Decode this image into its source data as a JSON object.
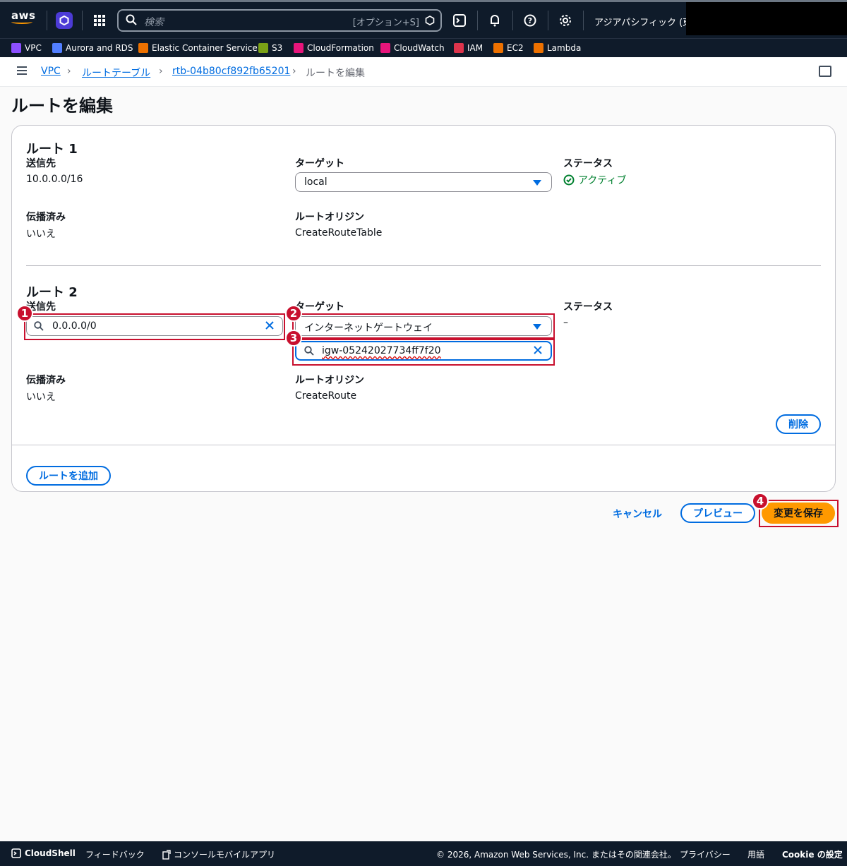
{
  "topbar": {
    "logo": "aws",
    "search_placeholder": "検索",
    "search_shortcut": "[オプション+S]",
    "region": "アジアパシフィック (東京)"
  },
  "bookmarks": [
    {
      "label": "VPC",
      "color": "#8c4fff"
    },
    {
      "label": "Aurora and RDS",
      "color": "#527fff"
    },
    {
      "label": "Elastic Container Service",
      "color": "#ed7100"
    },
    {
      "label": "S3",
      "color": "#7aa116"
    },
    {
      "label": "CloudFormation",
      "color": "#e7157b"
    },
    {
      "label": "CloudWatch",
      "color": "#e7157b"
    },
    {
      "label": "IAM",
      "color": "#dd344c"
    },
    {
      "label": "EC2",
      "color": "#ed7100"
    },
    {
      "label": "Lambda",
      "color": "#ed7100"
    }
  ],
  "breadcrumb": {
    "vpc": "VPC",
    "route_tables": "ルートテーブル",
    "rtb": "rtb-04b80cf892fb65201",
    "current": "ルートを編集"
  },
  "page_title": "ルートを編集",
  "route1": {
    "heading": "ルート 1",
    "dest_label": "送信先",
    "dest_value": "10.0.0.0/16",
    "target_label": "ターゲット",
    "target_value": "local",
    "status_label": "ステータス",
    "status_value": "アクティブ",
    "propagated_label": "伝播済み",
    "propagated_value": "いいえ",
    "origin_label": "ルートオリジン",
    "origin_value": "CreateRouteTable"
  },
  "route2": {
    "heading": "ルート 2",
    "dest_label": "送信先",
    "dest_value": "0.0.0.0/0",
    "target_label": "ターゲット",
    "target_value": "インターネットゲートウェイ",
    "target_id": "igw-05242027734ff7f20",
    "status_label": "ステータス",
    "status_value": "–",
    "propagated_label": "伝播済み",
    "propagated_value": "いいえ",
    "origin_label": "ルートオリジン",
    "origin_value": "CreateRoute",
    "delete_label": "削除"
  },
  "add_route_label": "ルートを追加",
  "actions": {
    "cancel": "キャンセル",
    "preview": "プレビュー",
    "save": "変更を保存"
  },
  "badges": [
    "1",
    "2",
    "3",
    "4"
  ],
  "footer": {
    "cloudshell": "CloudShell",
    "feedback": "フィードバック",
    "mobile_app": "コンソールモバイルアプリ",
    "copyright": "© 2026, Amazon Web Services, Inc. またはその関連会社。",
    "privacy": "プライバシー",
    "terms": "用語",
    "cookie": "Cookie の設定"
  },
  "colors": {
    "accent": "#006ce0",
    "primary": "#ff9900",
    "highlight": "#c8102e",
    "success": "#00802f"
  }
}
